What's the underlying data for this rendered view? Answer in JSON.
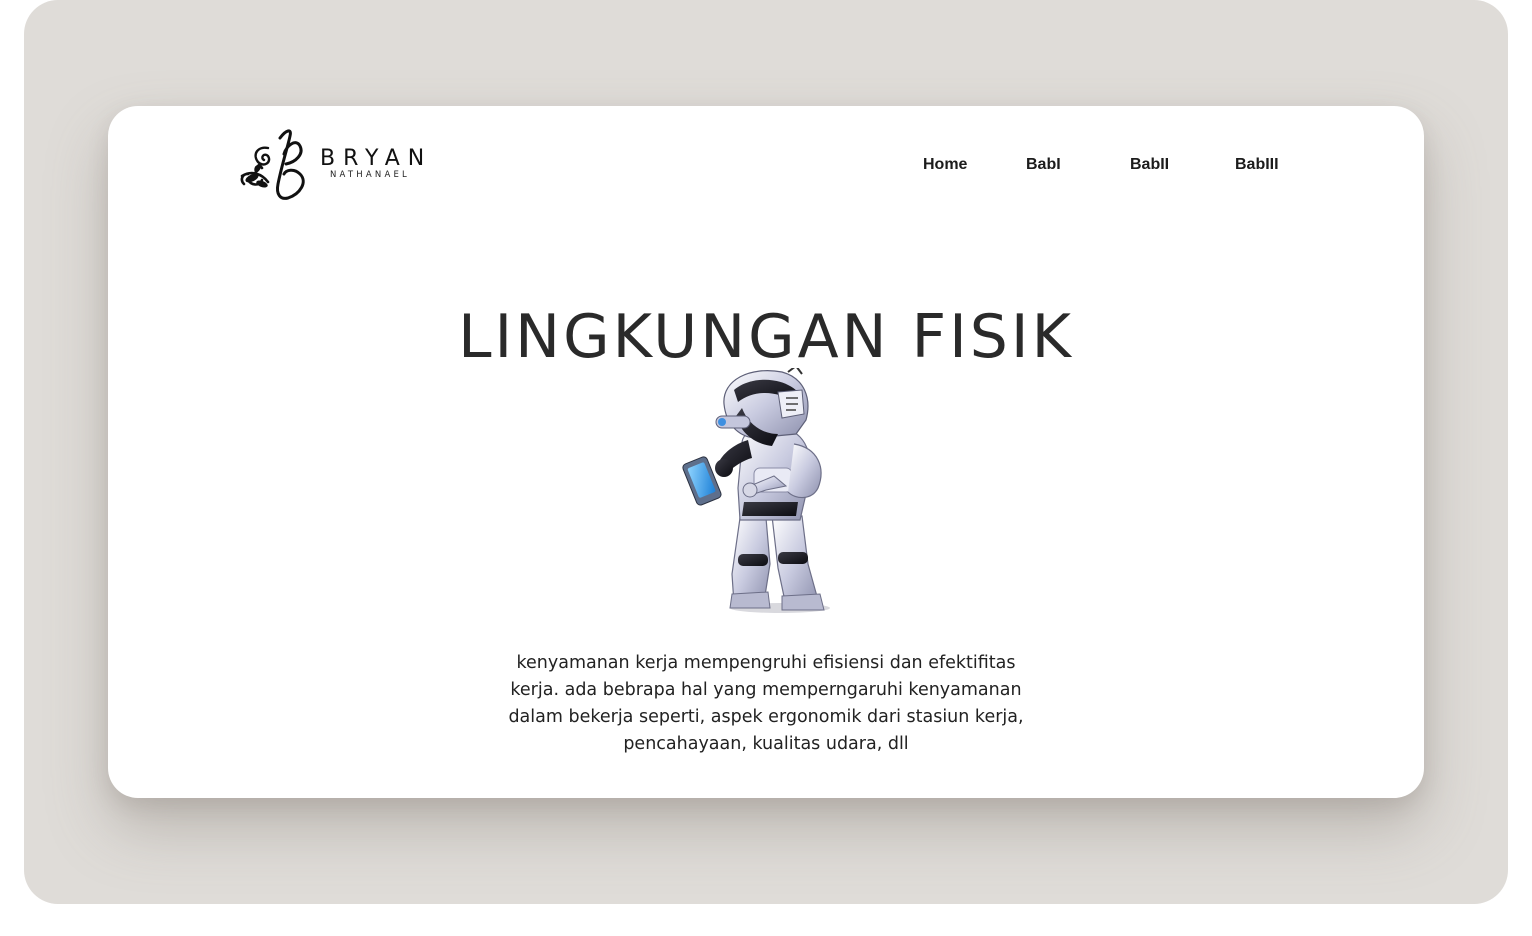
{
  "brand": {
    "name": "BRYAN",
    "subtitle": "NATHANAEL"
  },
  "nav": {
    "items": [
      "Home",
      "BabI",
      "BabII",
      "BabIII"
    ]
  },
  "main": {
    "title": "LINGKUNGAN FISIK",
    "description": "kenyamanan kerja mempengruhi efisiensi dan efektifitas kerja. ada bebrapa hal yang memperngaruhi kenyamanan dalam bekerja seperti, aspek ergonomik dari stasiun kerja, pencahayaan, kualitas udara, dll",
    "image": "robot-holding-phone"
  },
  "colors": {
    "outer_background": "#dfdcd8",
    "card_background": "#ffffff",
    "text": "#222222"
  }
}
